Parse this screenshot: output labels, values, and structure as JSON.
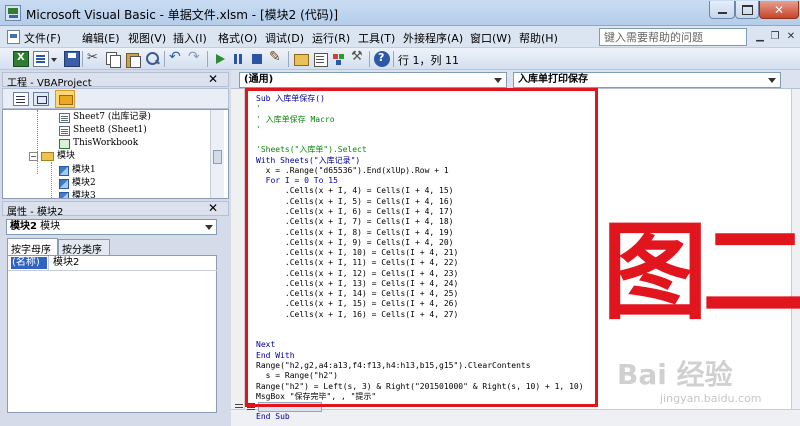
{
  "window": {
    "title": "Microsoft Visual Basic - 单据文件.xlsm - [模块2 (代码)]"
  },
  "menu": {
    "items": [
      "文件(F)",
      "编辑(E)",
      "视图(V)",
      "插入(I)",
      "格式(O)",
      "调试(D)",
      "运行(R)",
      "工具(T)",
      "外接程序(A)",
      "窗口(W)",
      "帮助(H)"
    ],
    "help_placeholder": "键入需要帮助的问题"
  },
  "toolbar": {
    "cursor_position": "行 1，列 11"
  },
  "project_panel": {
    "title": "工程 - VBAProject",
    "tree": [
      {
        "label": "Sheet7 (出库记录)",
        "icon": "sheet-icon"
      },
      {
        "label": "Sheet8 (Sheet1)",
        "icon": "sheet-icon"
      },
      {
        "label": "ThisWorkbook",
        "icon": "workbook-icon"
      },
      {
        "label": "模块",
        "icon": "folder-icon"
      },
      {
        "label": "模块1",
        "icon": "module-icon"
      },
      {
        "label": "模块2",
        "icon": "module-icon"
      },
      {
        "label": "模块3",
        "icon": "module-icon"
      }
    ]
  },
  "properties_panel": {
    "title": "属性 - 模块2",
    "object_name": "模块2",
    "object_type": "模块",
    "tabs": [
      "按字母序",
      "按分类序"
    ],
    "property_name": "(名称)",
    "property_value": "模块2"
  },
  "code_window": {
    "object_dropdown": "(通用)",
    "procedure_dropdown": "入库单打印保存",
    "lines": [
      {
        "text": "Sub 入库单保存()",
        "style": "kw"
      },
      {
        "text": "'",
        "style": "comment"
      },
      {
        "text": "' 入库单保存 Macro",
        "style": "comment"
      },
      {
        "text": "'",
        "style": "comment"
      },
      {
        "text": "",
        "style": ""
      },
      {
        "text": "'Sheets(\"入库单\").Select",
        "style": "comment"
      },
      {
        "text": "With Sheets(\"入库记录\")",
        "style": "kw"
      },
      {
        "text": "  x = .Range(\"d65536\").End(xlUp).Row + 1",
        "style": ""
      },
      {
        "text": "  For I = 0 To 15",
        "style": "kw"
      },
      {
        "text": "      .Cells(x + I, 4) = Cells(I + 4, 15)",
        "style": ""
      },
      {
        "text": "      .Cells(x + I, 5) = Cells(I + 4, 16)",
        "style": ""
      },
      {
        "text": "      .Cells(x + I, 6) = Cells(I + 4, 17)",
        "style": ""
      },
      {
        "text": "      .Cells(x + I, 7) = Cells(I + 4, 18)",
        "style": ""
      },
      {
        "text": "      .Cells(x + I, 8) = Cells(I + 4, 19)",
        "style": ""
      },
      {
        "text": "      .Cells(x + I, 9) = Cells(I + 4, 20)",
        "style": ""
      },
      {
        "text": "      .Cells(x + I, 10) = Cells(I + 4, 21)",
        "style": ""
      },
      {
        "text": "      .Cells(x + I, 11) = Cells(I + 4, 22)",
        "style": ""
      },
      {
        "text": "      .Cells(x + I, 12) = Cells(I + 4, 23)",
        "style": ""
      },
      {
        "text": "      .Cells(x + I, 13) = Cells(I + 4, 24)",
        "style": ""
      },
      {
        "text": "      .Cells(x + I, 14) = Cells(I + 4, 25)",
        "style": ""
      },
      {
        "text": "      .Cells(x + I, 15) = Cells(I + 4, 26)",
        "style": ""
      },
      {
        "text": "      .Cells(x + I, 16) = Cells(I + 4, 27)",
        "style": ""
      },
      {
        "text": "",
        "style": ""
      },
      {
        "text": "",
        "style": ""
      },
      {
        "text": "Next",
        "style": "kw"
      },
      {
        "text": "End With",
        "style": "kw"
      },
      {
        "text": "Range(\"h2,g2,a4:a13,f4:f13,h4:h13,b15,g15\").ClearContents",
        "style": ""
      },
      {
        "text": "  s = Range(\"h2\")",
        "style": ""
      },
      {
        "text": "Range(\"h2\") = Left(s, 3) & Right(\"201501000\" & Right(s, 10) + 1, 10)",
        "style": ""
      },
      {
        "text": "MsgBox \"保存完毕\", , \"提示\"",
        "style": ""
      },
      {
        "text": "",
        "style": ""
      },
      {
        "text": "End Sub",
        "style": "kw"
      }
    ]
  },
  "annotation": {
    "label": "图二",
    "color": "#e1151e"
  },
  "watermark": {
    "logo": "Bai 经验",
    "url": "jingyan.baidu.com"
  }
}
